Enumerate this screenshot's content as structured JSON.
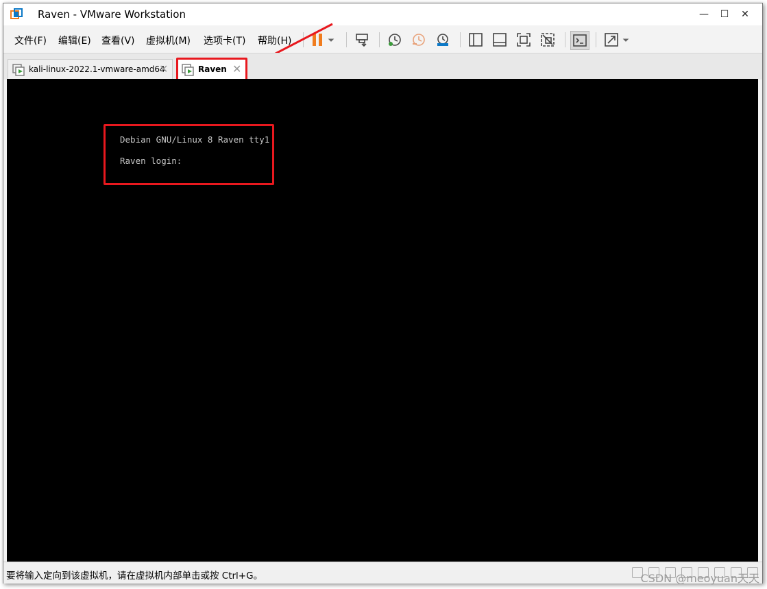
{
  "window": {
    "title": "Raven - VMware Workstation",
    "controls": {
      "minimize": "—",
      "maximize": "☐",
      "close": "✕"
    }
  },
  "menu": {
    "items": [
      "文件(F)",
      "编辑(E)",
      "查看(V)",
      "虚拟机(M)",
      "选项卡(T)",
      "帮助(H)"
    ]
  },
  "toolbar": {
    "icons": [
      "pause-icon",
      "dropdown-arrow-icon",
      "send-ctrl-alt-del-icon",
      "snapshot-take-icon",
      "snapshot-revert-icon",
      "snapshot-manager-icon",
      "show-library-icon",
      "show-thumbnail-bar-icon",
      "full-screen-icon",
      "unity-icon",
      "console-view-icon",
      "stretch-guest-icon",
      "dropdown-arrow-icon"
    ]
  },
  "tabs": [
    {
      "label": "kali-linux-2022.1-vmware-amd64",
      "active": false,
      "close": "✕"
    },
    {
      "label": "Raven",
      "active": true,
      "close": "✕"
    }
  ],
  "console": {
    "lines": [
      "Debian GNU/Linux 8 Raven tty1",
      "Raven login:"
    ]
  },
  "statusbar": {
    "message": "要将输入定向到该虚拟机，请在虚拟机内部单击或按 Ctrl+G。",
    "watermark": "CSDN @meoyuan天天"
  },
  "colors": {
    "annotation": "#e8181e",
    "pause": "#f07c1e",
    "vm_background": "#000000",
    "console_text": "#c6c6c6"
  }
}
